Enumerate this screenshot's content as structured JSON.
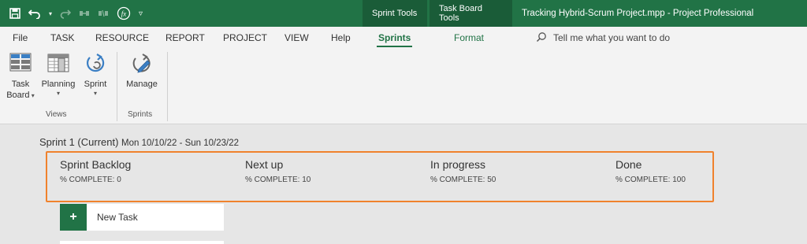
{
  "app": {
    "window_title": "Tracking Hybrid-Scrum Project.mpp  -  Project Professional",
    "context_tabs": [
      "Sprint Tools",
      "Task Board Tools"
    ],
    "brand_color": "#217346"
  },
  "quick_access": [
    "save-icon",
    "undo-icon",
    "redo-icon",
    "link-icon",
    "unlink-icon",
    "function-icon",
    "customize-icon"
  ],
  "menu": {
    "tabs": [
      "File",
      "TASK",
      "RESOURCE",
      "REPORT",
      "PROJECT",
      "VIEW",
      "Help",
      "Sprints",
      "Format"
    ],
    "active_tab": "Sprints",
    "tell_me": "Tell me what you want to do"
  },
  "ribbon": {
    "views_group": {
      "label": "Views",
      "buttons": [
        {
          "line1": "Task",
          "line2": "Board",
          "icon": "task-board-icon"
        },
        {
          "line1": "Planning",
          "line2": "",
          "icon": "planning-icon"
        },
        {
          "line1": "Sprint",
          "line2": "",
          "icon": "sprint-icon"
        }
      ]
    },
    "sprints_group": {
      "label": "Sprints",
      "buttons": [
        {
          "line1": "Manage",
          "icon": "manage-sprints-icon"
        }
      ]
    }
  },
  "board": {
    "sprint_name": "Sprint 1 (Current)",
    "sprint_dates": "Mon 10/10/22 - Sun 10/23/22",
    "highlight_color": "#f0822d",
    "columns": [
      {
        "title": "Sprint Backlog",
        "pct_label": "% COMPLETE: 0",
        "pct": 0
      },
      {
        "title": "Next up",
        "pct_label": "% COMPLETE: 10",
        "pct": 10
      },
      {
        "title": "In progress",
        "pct_label": "% COMPLETE: 50",
        "pct": 50
      },
      {
        "title": "Done",
        "pct_label": "% COMPLETE: 100",
        "pct": 100
      }
    ],
    "new_task_label": "New Task"
  }
}
